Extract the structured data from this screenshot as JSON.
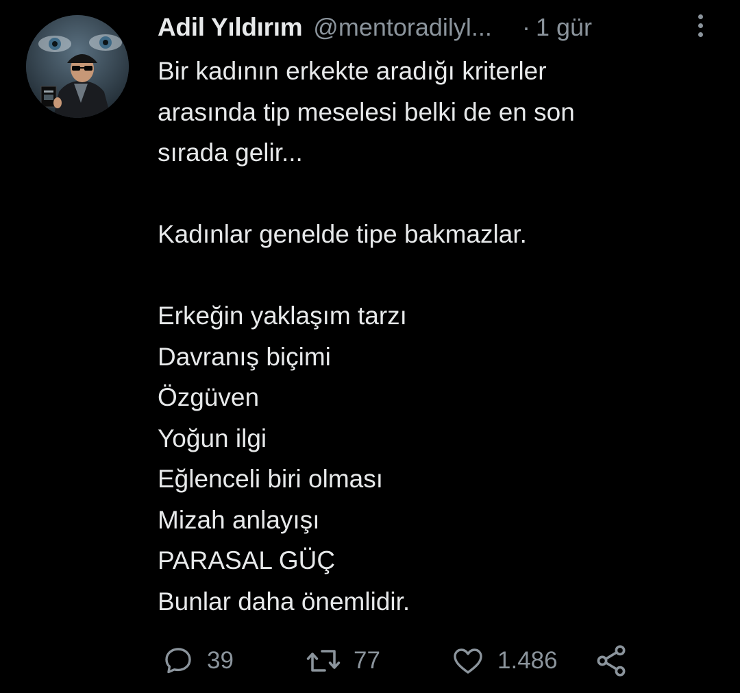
{
  "author": {
    "display_name": "Adil Yıldırım",
    "handle": "@mentoradilyl...",
    "time_separator": "·",
    "time": "1 gür"
  },
  "tweet": {
    "lines": [
      "Bir kadının erkekte aradığı kriterler",
      "arasında tip meselesi belki de en son",
      "sırada gelir...",
      "",
      "Kadınlar genelde tipe bakmazlar.",
      "",
      "Erkeğin yaklaşım tarzı",
      "Davranış biçimi",
      "Özgüven",
      "Yoğun ilgi",
      "Eğlenceli biri olması",
      "Mizah anlayışı",
      "PARASAL GÜÇ",
      "Bunlar daha önemlidir."
    ]
  },
  "actions": {
    "reply_count": "39",
    "retweet_count": "77",
    "like_count": "1.486"
  },
  "icons": {
    "reply": "speech-bubble-icon",
    "retweet": "retweet-arrows-icon",
    "like": "heart-icon",
    "share": "share-nodes-icon",
    "more": "vertical-ellipsis-icon"
  },
  "colors": {
    "background": "#000000",
    "text_primary": "#e7e9ea",
    "text_secondary": "#8b949c"
  }
}
